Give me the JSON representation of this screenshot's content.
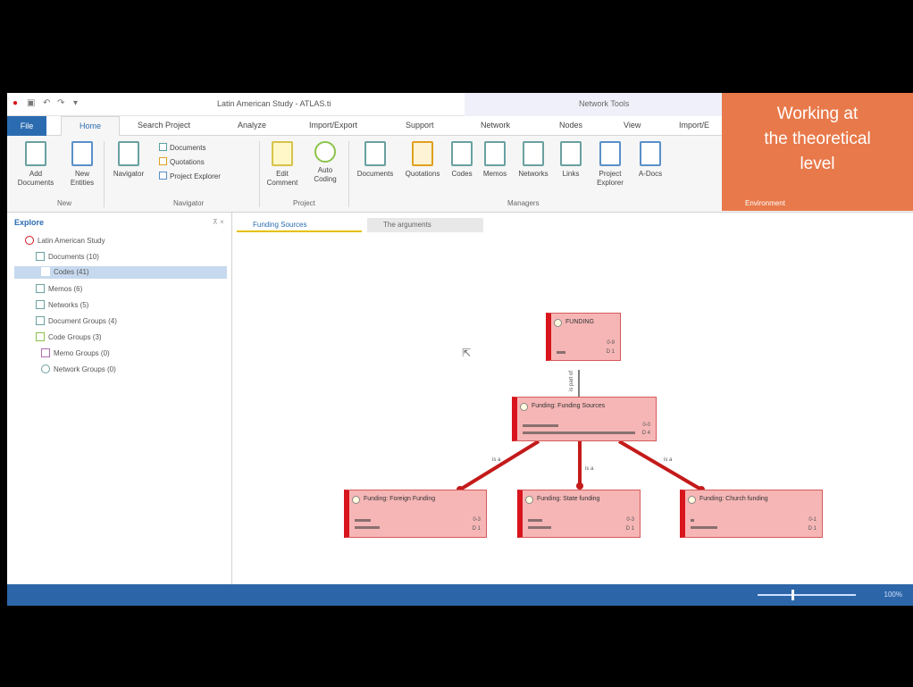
{
  "window": {
    "title": "Latin American Study - ATLAS.ti",
    "context_title": "Network Tools"
  },
  "tabs": {
    "file": "File",
    "home": "Home",
    "search_project": "Search Project",
    "analyze": "Analyze",
    "import_export": "Import/Export",
    "support": "Support",
    "network": "Network",
    "nodes": "Nodes",
    "view": "View",
    "import2": "Import/E"
  },
  "ribbon": {
    "add_documents": "Add Documents",
    "new_entities": "New Entities",
    "navigator": "Navigator",
    "documents_small": "Documents",
    "quotations_small": "Quotations",
    "project_explorer_small": "Project Explorer",
    "edit_comment": "Edit Comment",
    "auto_coding": "Auto Coding",
    "documents": "Documents",
    "quotations": "Quotations",
    "codes": "Codes",
    "memos": "Memos",
    "networks": "Networks",
    "links": "Links",
    "project_explorer": "Project Explorer",
    "a_docs": "A-Docs",
    "groups": {
      "new": "New",
      "navigator": "Navigator",
      "project": "Project",
      "managers": "Managers",
      "environment": "Environment"
    }
  },
  "callout": {
    "line1": "Working at",
    "line2": "the theoretical",
    "line3": "level"
  },
  "explorer": {
    "title": "Explore",
    "root": "Latin American Study",
    "items": [
      "Documents (10)",
      "Codes (41)",
      "Memos (6)",
      "Networks (5)",
      "Document Groups (4)",
      "Code Groups (3)",
      "Memo Groups (0)",
      "Network Groups (0)"
    ]
  },
  "editor_tabs": [
    "Funding Sources",
    "The arguments"
  ],
  "network": {
    "nodes": [
      {
        "label": "FUNDING",
        "g": "0-9",
        "d": "D 1"
      },
      {
        "label": "Funding: Funding Sources",
        "g": "0-0",
        "d": "D 4"
      },
      {
        "label": "Funding: Foreign Funding",
        "g": "0-3",
        "d": "D 1"
      },
      {
        "label": "Funding: State funding",
        "g": "0-3",
        "d": "D 1"
      },
      {
        "label": "Funding: Church funding",
        "g": "0-1",
        "d": "D 1"
      }
    ],
    "edge_labels": [
      "is part of",
      "is a",
      "is a",
      "is a"
    ]
  },
  "status": {
    "zoom": "100%"
  }
}
